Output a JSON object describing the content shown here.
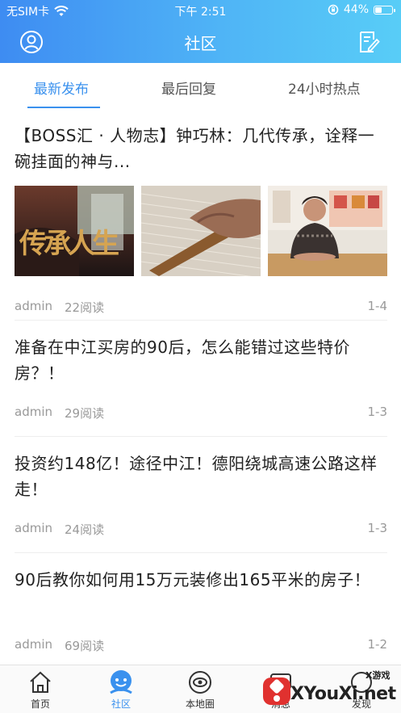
{
  "status_bar": {
    "carrier": "无SIM卡",
    "time": "下午 2:51",
    "battery_percent": "44%",
    "battery_level": 0.44
  },
  "navbar": {
    "title": "社区",
    "left_icon": "user-circle-icon",
    "right_icon": "edit-note-icon"
  },
  "tabs": [
    {
      "label": "最新发布",
      "active": true
    },
    {
      "label": "最后回复",
      "active": false
    },
    {
      "label": "24小时热点",
      "active": false
    }
  ],
  "posts": [
    {
      "title": "【BOSS汇 · 人物志】钟巧林：几代传承，诠释一碗挂面的神与...",
      "author": "admin",
      "reads": "22阅读",
      "date": "1-4",
      "thumb_overlay_text": "传承人生"
    },
    {
      "title": "准备在中江买房的90后，怎么能错过这些特价房？！",
      "author": "admin",
      "reads": "29阅读",
      "date": "1-3"
    },
    {
      "title": "投资约148亿！途径中江！德阳绕城高速公路这样走！",
      "author": "admin",
      "reads": "24阅读",
      "date": "1-3"
    },
    {
      "title": "90后教你如何用15万元装修出165平米的房子！",
      "author": "admin",
      "reads": "69阅读",
      "date": "1-2"
    }
  ],
  "tabbar": [
    {
      "label": "首页",
      "icon": "home-icon",
      "active": false
    },
    {
      "label": "社区",
      "icon": "community-icon",
      "active": true
    },
    {
      "label": "本地圈",
      "icon": "local-circle-icon",
      "active": false
    },
    {
      "label": "消息",
      "icon": "message-icon",
      "active": false
    },
    {
      "label": "发现",
      "icon": "discover-icon",
      "active": false
    }
  ],
  "watermark": {
    "text": "XYouXi.net",
    "small": "X游戏"
  },
  "colors": {
    "accent": "#3a91ee",
    "header_start": "#3e8cf2",
    "header_end": "#58cdf7"
  }
}
